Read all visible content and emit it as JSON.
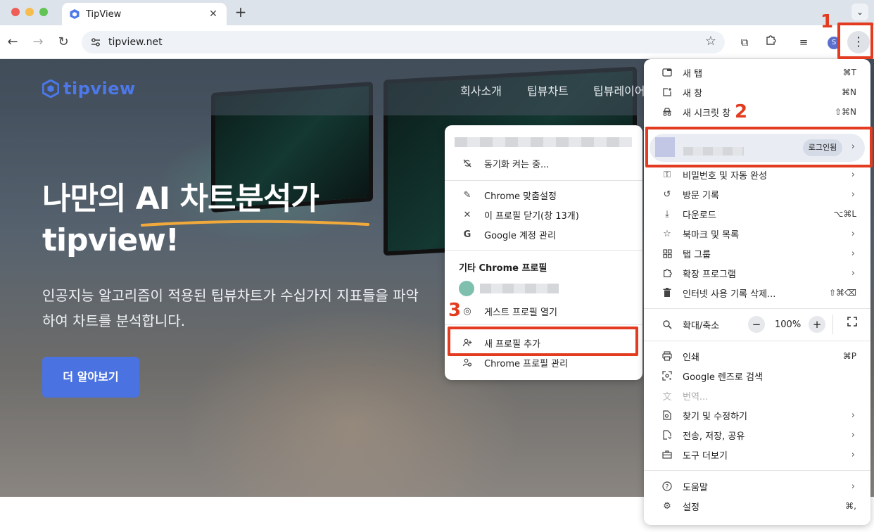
{
  "browser": {
    "tab_title": "TipView",
    "new_tab_symbol": "+",
    "url": "tipview.net",
    "avatar_letter": "S"
  },
  "site": {
    "logo_text": "tipview",
    "nav": [
      "회사소개",
      "팁뷰차트",
      "팁뷰레이어"
    ],
    "headline_line1": "나만의 AI 차트분석가",
    "headline_line2": "tipview!",
    "subtext": "인공지능 알고리즘이 적용된 팁뷰차트가 수십가지 지표들을 파악하여 차트를 분석합니다.",
    "cta": "더 알아보기"
  },
  "annotations": {
    "step1": "1",
    "step2": "2",
    "step3": "3"
  },
  "menu": {
    "new_tab": {
      "label": "새 탭",
      "shortcut": "⌘T",
      "icon": "new-tab-icon"
    },
    "new_window": {
      "label": "새 창",
      "shortcut": "⌘N",
      "icon": "new-window-icon"
    },
    "incognito": {
      "label": "새 시크릿 창",
      "shortcut": "⇧⌘N",
      "icon": "incognito-icon"
    },
    "profile_badge": "로그인됨",
    "passwords": {
      "label": "비밀번호 및 자동 완성",
      "icon": "key-icon"
    },
    "history": {
      "label": "방문 기록",
      "icon": "history-icon"
    },
    "downloads": {
      "label": "다운로드",
      "shortcut": "⌥⌘L",
      "icon": "download-icon"
    },
    "bookmarks": {
      "label": "북마크 및 목록",
      "icon": "star-icon"
    },
    "tab_groups": {
      "label": "탭 그룹",
      "icon": "grid-icon"
    },
    "extensions": {
      "label": "확장 프로그램",
      "icon": "puzzle-icon"
    },
    "clear_data": {
      "label": "인터넷 사용 기록 삭제...",
      "shortcut": "⇧⌘⌫",
      "icon": "trash-icon"
    },
    "zoom": {
      "label": "확대/축소",
      "minus": "−",
      "value": "100%",
      "plus": "+",
      "icon": "zoom-icon"
    },
    "print": {
      "label": "인쇄",
      "shortcut": "⌘P",
      "icon": "print-icon"
    },
    "lens": {
      "label": "Google 렌즈로 검색",
      "icon": "lens-icon"
    },
    "translate": {
      "label": "번역...",
      "icon": "translate-icon"
    },
    "find": {
      "label": "찾기 및 수정하기",
      "icon": "find-icon"
    },
    "cast": {
      "label": "전송, 저장, 공유",
      "icon": "cast-icon"
    },
    "tools": {
      "label": "도구 더보기",
      "icon": "toolbox-icon"
    },
    "help": {
      "label": "도움말",
      "icon": "help-icon"
    },
    "settings": {
      "label": "설정",
      "shortcut": "⌘,",
      "icon": "gear-icon"
    }
  },
  "profile_menu": {
    "sync": "동기화 켜는 중...",
    "customize": "Chrome 맞춤설정",
    "close_profile": "이 프로필 닫기(창 13개)",
    "manage_account": "Google 계정 관리",
    "other_header": "기타 Chrome 프로필",
    "guest": "게스트 프로필 열기",
    "add_profile": "새 프로필 추가",
    "manage_profiles": "Chrome 프로필 관리"
  }
}
